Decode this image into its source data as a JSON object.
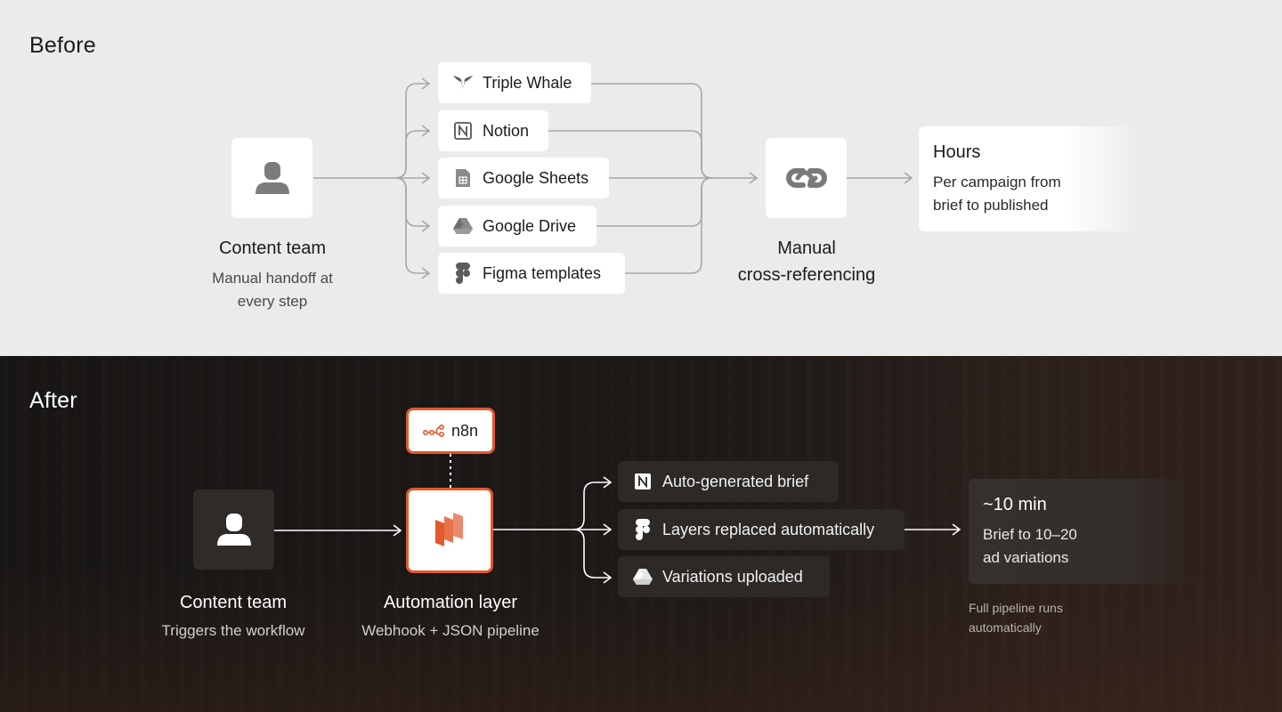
{
  "before": {
    "title": "Before",
    "actor": {
      "title": "Content team",
      "subtitle_line1": "Manual handoff at",
      "subtitle_line2": "every step",
      "icon": "user-icon"
    },
    "tools": [
      {
        "label": "Triple Whale",
        "icon": "triple-whale-icon"
      },
      {
        "label": "Notion",
        "icon": "notion-icon"
      },
      {
        "label": "Google Sheets",
        "icon": "google-sheets-icon"
      },
      {
        "label": "Google Drive",
        "icon": "google-drive-icon"
      },
      {
        "label": "Figma templates",
        "icon": "figma-icon"
      }
    ],
    "merge": {
      "title_line1": "Manual",
      "title_line2": "cross-referencing",
      "icon": "link-icon"
    },
    "result": {
      "title": "Hours",
      "desc_line1": "Per campaign from",
      "desc_line2": "brief to published"
    }
  },
  "after": {
    "title": "After",
    "actor": {
      "title": "Content team",
      "subtitle": "Triggers the workflow",
      "icon": "user-icon"
    },
    "engine": {
      "label": "n8n",
      "icon": "n8n-icon"
    },
    "automation": {
      "title": "Automation layer",
      "subtitle": "Webhook + JSON pipeline",
      "icon": "automation-stack-icon"
    },
    "outputs": [
      {
        "label": "Auto-generated brief",
        "icon": "notion-icon"
      },
      {
        "label": "Layers replaced automatically",
        "icon": "figma-icon"
      },
      {
        "label": "Variations uploaded",
        "icon": "google-drive-icon"
      }
    ],
    "result": {
      "title": "~10 min",
      "desc_line1": "Brief to 10–20",
      "desc_line2": "ad variations"
    },
    "footnote_line1": "Full pipeline runs",
    "footnote_line2": "automatically"
  },
  "colors": {
    "accent": "#e4582d",
    "light_bg": "#ebebeb",
    "dark_bg": "#1b1816",
    "wire_light": "#a3a3a3",
    "wire_dark": "#ffffff"
  }
}
